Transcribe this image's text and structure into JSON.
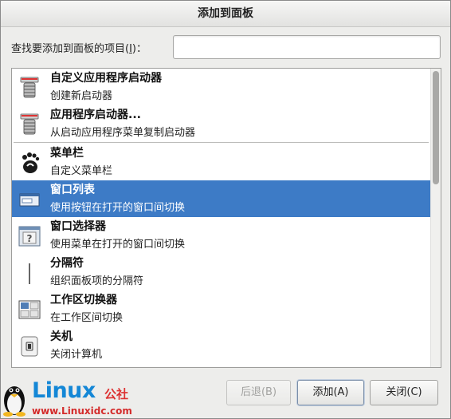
{
  "dialog": {
    "title": "添加到面板"
  },
  "search": {
    "label_prefix": "查找要添加到面板的项目(",
    "label_mnemonic": "I",
    "label_suffix": ")：",
    "value": ""
  },
  "items": [
    {
      "name": "自定义应用程序启动器",
      "desc": "创建新启动器",
      "icon": "launcher-icon"
    },
    {
      "name": "应用程序启动器...",
      "desc": "从启动应用程序菜单复制启动器",
      "icon": "launcher-icon"
    },
    {
      "name": "菜单栏",
      "desc": "自定义菜单栏",
      "icon": "gnome-foot-icon"
    },
    {
      "name": "窗口列表",
      "desc": "使用按钮在打开的窗口间切换",
      "icon": "window-list-icon",
      "selected": true
    },
    {
      "name": "窗口选择器",
      "desc": "使用菜单在打开的窗口间切换",
      "icon": "window-selector-icon"
    },
    {
      "name": "分隔符",
      "desc": "组织面板项的分隔符",
      "icon": "separator-icon"
    },
    {
      "name": "工作区切换器",
      "desc": "在工作区间切换",
      "icon": "workspace-switcher-icon"
    },
    {
      "name": "关机",
      "desc": "关闭计算机",
      "icon": "shutdown-icon"
    }
  ],
  "buttons": {
    "back": {
      "label": "后退(B)",
      "enabled": false
    },
    "add": {
      "label": "添加(A)"
    },
    "close": {
      "label": "关闭(C)"
    }
  },
  "watermark": {
    "brand": "Linux",
    "brand_cn": "公社",
    "url": "www.Linuxidc.com"
  }
}
